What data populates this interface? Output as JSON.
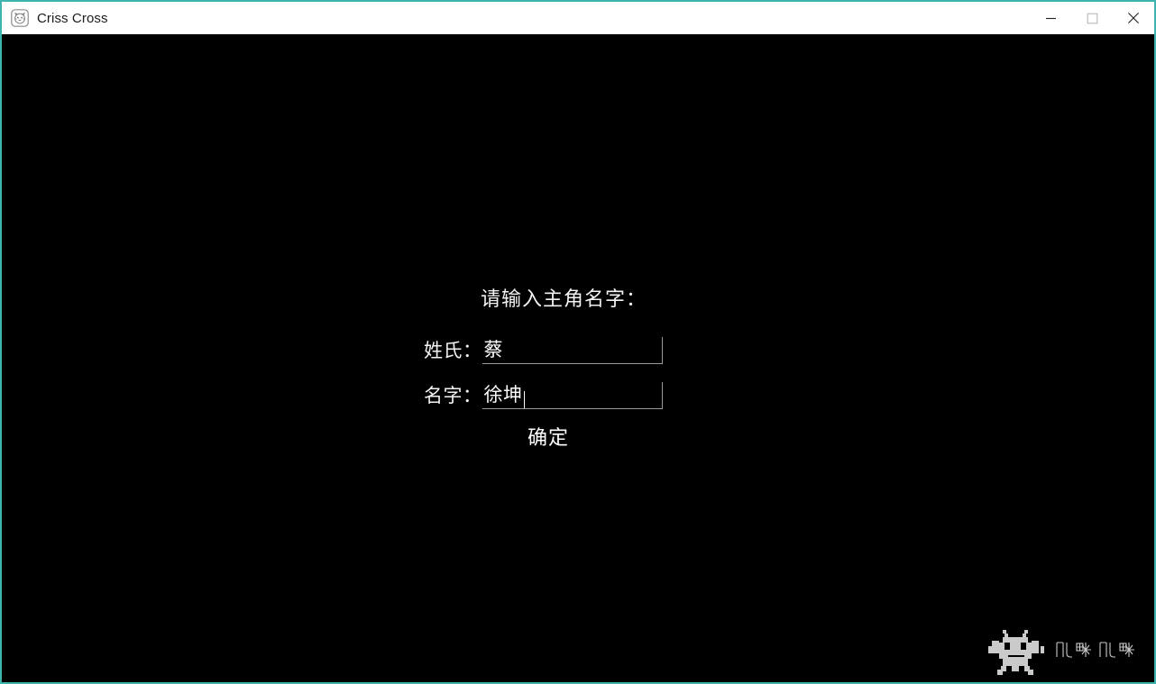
{
  "window": {
    "title": "Criss Cross",
    "icon": "cat-face-icon",
    "border_color": "#3fb3ae",
    "titlebar_bg": "#ffffff",
    "controls": [
      {
        "name": "minimize",
        "glyph": "minimize-icon",
        "label": "Minimize"
      },
      {
        "name": "maximize",
        "glyph": "maximize-icon",
        "label": "Maximize"
      },
      {
        "name": "close",
        "glyph": "close-icon",
        "label": "Close"
      }
    ]
  },
  "game": {
    "background_color": "#000000",
    "text_color": "#ffffff"
  },
  "dialog": {
    "heading": "请输入主角名字：",
    "fields": [
      {
        "key": "surname",
        "label": "姓氏：",
        "value": "蔡",
        "placeholder": "",
        "focused": false
      },
      {
        "key": "given_name",
        "label": "名字：",
        "value": "徐坤",
        "placeholder": "",
        "focused": true
      }
    ],
    "confirm_label": "确定"
  },
  "watermark": {
    "mascot": "pixel-robot-icon",
    "text": "叽咪叽咪",
    "color": "#e8e8e8"
  }
}
